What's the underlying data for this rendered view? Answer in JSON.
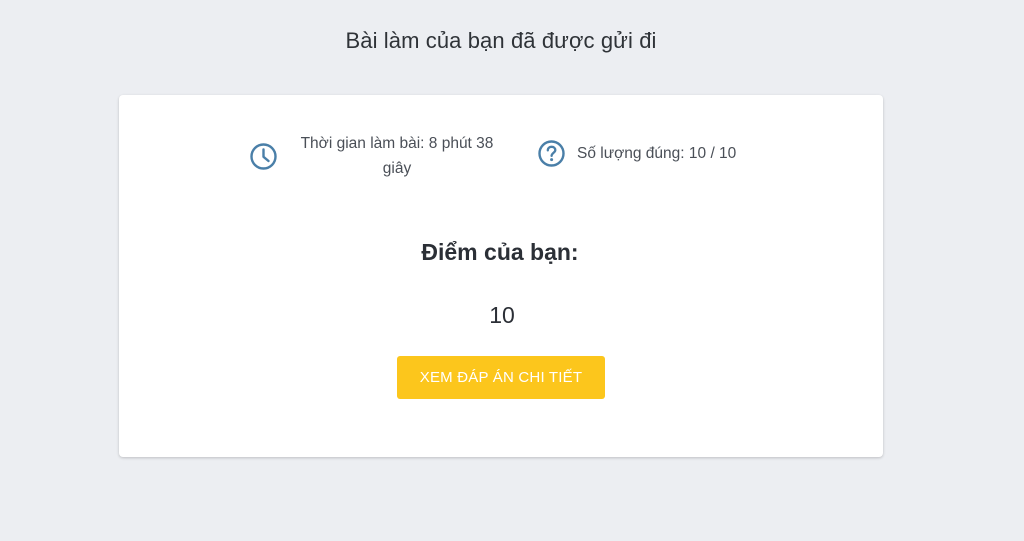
{
  "page": {
    "title": "Bài làm của bạn đã được gửi đi"
  },
  "stats": {
    "time": {
      "icon": "clock-icon",
      "label": "Thời gian làm bài: 8 phút 38 giây"
    },
    "correct": {
      "icon": "question-circle-icon",
      "label": "Số lượng đúng: 10 / 10"
    }
  },
  "score": {
    "label": "Điểm của bạn:",
    "value": "10"
  },
  "actions": {
    "view_detail_label": "XEM ĐÁP ÁN CHI TIẾT"
  },
  "colors": {
    "background": "#eceef2",
    "card": "#ffffff",
    "icon": "#4a7fa8",
    "button": "#fcc61c",
    "button_text": "#ffffff"
  }
}
